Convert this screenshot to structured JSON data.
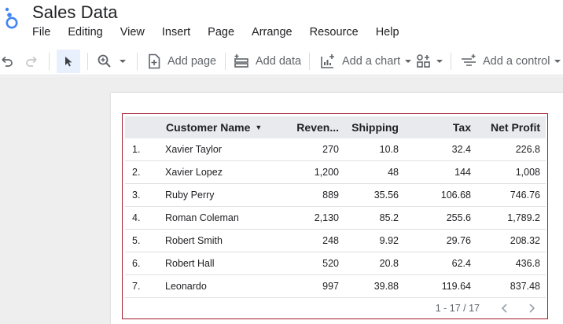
{
  "app": {
    "title": "Sales Data",
    "menu": [
      "File",
      "Editing",
      "View",
      "Insert",
      "Page",
      "Arrange",
      "Resource",
      "Help"
    ]
  },
  "toolbar": {
    "undo_icon": "undo-icon",
    "redo_icon": "redo-icon",
    "select_icon": "pointer-icon",
    "zoom_icon": "zoom-in-icon",
    "add_page": "Add page",
    "add_data": "Add data",
    "add_chart": "Add a chart",
    "add_control": "Add a control"
  },
  "table": {
    "headers": {
      "index": "",
      "customer": "Customer Name",
      "revenue": "Reven...",
      "shipping": "Shipping",
      "tax": "Tax",
      "net_profit": "Net Profit"
    },
    "rows": [
      {
        "idx": "1.",
        "name": "Xavier Taylor",
        "revenue": "270",
        "shipping": "10.8",
        "tax": "32.4",
        "net": "226.8"
      },
      {
        "idx": "2.",
        "name": "Xavier Lopez",
        "revenue": "1,200",
        "shipping": "48",
        "tax": "144",
        "net": "1,008"
      },
      {
        "idx": "3.",
        "name": "Ruby Perry",
        "revenue": "889",
        "shipping": "35.56",
        "tax": "106.68",
        "net": "746.76"
      },
      {
        "idx": "4.",
        "name": "Roman Coleman",
        "revenue": "2,130",
        "shipping": "85.2",
        "tax": "255.6",
        "net": "1,789.2"
      },
      {
        "idx": "5.",
        "name": "Robert Smith",
        "revenue": "248",
        "shipping": "9.92",
        "tax": "29.76",
        "net": "208.32"
      },
      {
        "idx": "6.",
        "name": "Robert Hall",
        "revenue": "520",
        "shipping": "20.8",
        "tax": "62.4",
        "net": "436.8"
      },
      {
        "idx": "7.",
        "name": "Leonardo",
        "revenue": "997",
        "shipping": "39.88",
        "tax": "119.64",
        "net": "837.48"
      }
    ],
    "pagination": "1 - 17 / 17",
    "border_color": "#a51c30",
    "header_bg": "#e8eaed"
  }
}
